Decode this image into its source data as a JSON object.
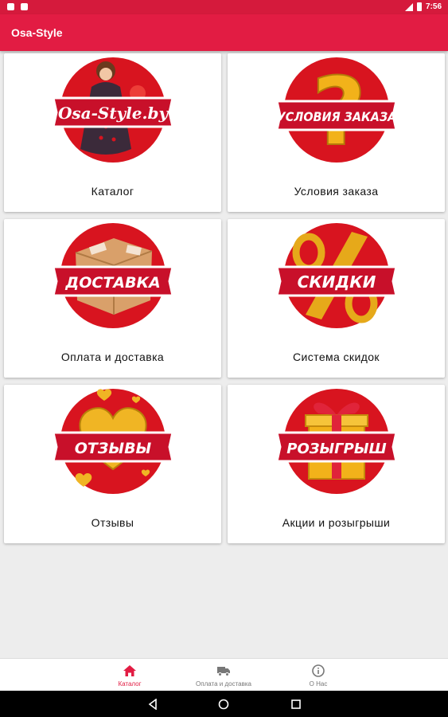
{
  "status_bar": {
    "time": "7:56"
  },
  "app_bar": {
    "title": "Osa-Style"
  },
  "cards": [
    {
      "label": "Каталог",
      "banner": "Osa-Style.by",
      "icon": "girl-photo"
    },
    {
      "label": "Условия заказа",
      "banner": "УСЛОВИЯ ЗАКАЗА",
      "icon": "question-mark"
    },
    {
      "label": "Оплата и доставка",
      "banner": "ДОСТАВКА",
      "icon": "parcel-box"
    },
    {
      "label": "Система скидок",
      "banner": "СКИДКИ",
      "icon": "percent-sign"
    },
    {
      "label": "Отзывы",
      "banner": "ОТЗЫВЫ",
      "icon": "golden-hearts"
    },
    {
      "label": "Акции и розыгрыши",
      "banner": "РОЗЫГРЫШ",
      "icon": "gift-box"
    }
  ],
  "bottom_nav": [
    {
      "label": "Каталог",
      "icon": "home-icon",
      "active": true
    },
    {
      "label": "Оплата и доставка",
      "icon": "truck-icon",
      "active": false
    },
    {
      "label": "О Нас",
      "icon": "info-icon",
      "active": false
    }
  ],
  "colors": {
    "primary": "#e21c43",
    "status_bar": "#d51a3c",
    "badge_red": "#d8141f",
    "gold": "#f2b21a"
  }
}
